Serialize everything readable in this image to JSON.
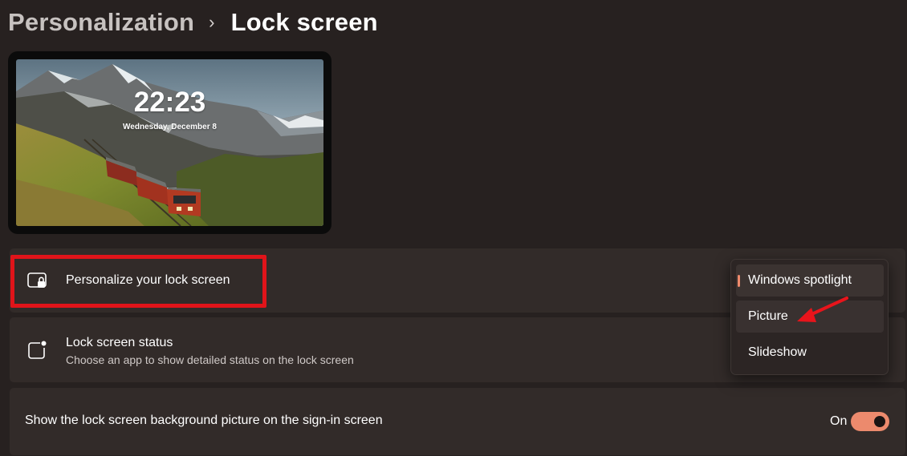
{
  "breadcrumb": {
    "parent": "Personalization",
    "separator": "›",
    "current": "Lock screen"
  },
  "preview": {
    "time": "22:23",
    "date": "Wednesday, December 8"
  },
  "settings": {
    "personalize": {
      "title": "Personalize your lock screen",
      "icon": "lock-screen-icon"
    },
    "status": {
      "title": "Lock screen status",
      "subtitle": "Choose an app to show detailed status on the lock screen",
      "icon": "app-status-icon"
    },
    "signin": {
      "title": "Show the lock screen background picture on the sign-in screen",
      "toggle_label": "On",
      "toggle_on": true
    }
  },
  "dropdown": {
    "selected": "Windows spotlight",
    "options": [
      "Windows spotlight",
      "Picture",
      "Slideshow"
    ]
  },
  "colors": {
    "accent": "#ec8a6d",
    "highlight": "#e0141a",
    "background": "#272120",
    "card": "#322b29"
  }
}
